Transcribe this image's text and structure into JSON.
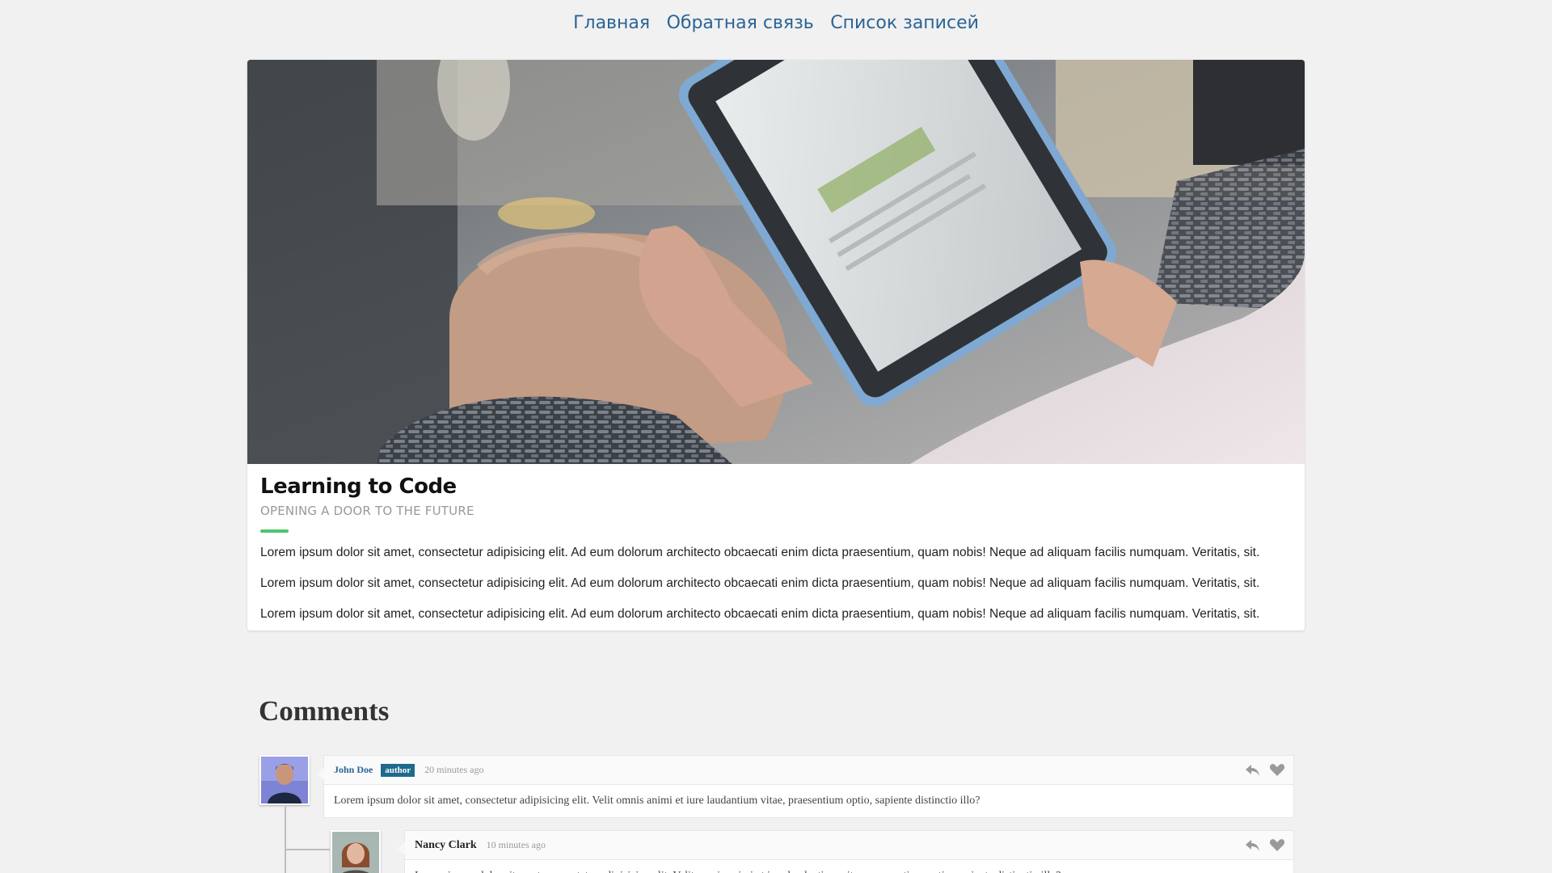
{
  "nav": {
    "items": [
      "Главная",
      "Обратная связь",
      "Список записей"
    ]
  },
  "post": {
    "title": "Learning to Code",
    "subtitle": "Opening a door to the future",
    "paragraphs": [
      "Lorem ipsum dolor sit amet, consectetur adipisicing elit. Ad eum dolorum architecto obcaecati enim dicta praesentium, quam nobis! Neque ad aliquam facilis numquam. Veritatis, sit.",
      "Lorem ipsum dolor sit amet, consectetur adipisicing elit. Ad eum dolorum architecto obcaecati enim dicta praesentium, quam nobis! Neque ad aliquam facilis numquam. Veritatis, sit.",
      "Lorem ipsum dolor sit amet, consectetur adipisicing elit. Ad eum dolorum architecto obcaecati enim dicta praesentium, quam nobis! Neque ad aliquam facilis numquam. Veritatis, sit."
    ],
    "accent_color": "#4cc66b"
  },
  "comments": {
    "heading": "Comments",
    "items": [
      {
        "author": "John Doe",
        "badge": "author",
        "time": "20 minutes ago",
        "text": "Lorem ipsum dolor sit amet, consectetur adipisicing elit. Velit omnis animi et iure laudantium vitae, praesentium optio, sapiente distinctio illo?"
      },
      {
        "author": "Nancy Clark",
        "time": "10 minutes ago",
        "text": "Lorem ipsum dolor sit amet, consectetur adipisicing elit. Velit omnis animi et iure laudantium vitae, praesentium optio, sapiente distinctio illo?"
      }
    ],
    "icons": [
      "reply-icon",
      "heart-icon"
    ]
  },
  "colors": {
    "link": "#2a6496",
    "badge": "#1e6a8d",
    "background": "#f1f1f1"
  }
}
